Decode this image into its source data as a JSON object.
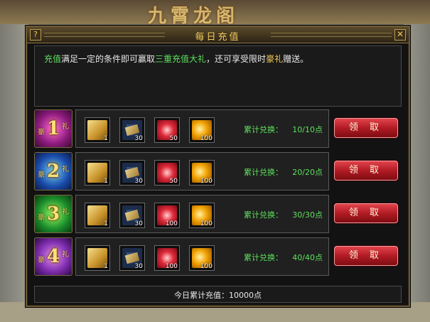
{
  "background": {
    "title": "九霄龙阁"
  },
  "window": {
    "title": "每日充值",
    "help_label": "?",
    "close_label": "✕"
  },
  "description": {
    "p1": "充值",
    "p2": "满足一定的条件即可赢取",
    "p3": "三重充值大礼",
    "p4": "，还可享受限时",
    "p5": "豪礼",
    "p6": "赠送。"
  },
  "rows": [
    {
      "badge_num": "1",
      "badge_a": "豪",
      "badge_b": "礼",
      "items": [
        "1",
        "30",
        "50",
        "100"
      ],
      "label": "累计兑换：",
      "progress": "10/10点",
      "button": "领 取"
    },
    {
      "badge_num": "2",
      "badge_a": "豪",
      "badge_b": "礼",
      "items": [
        "1",
        "30",
        "50",
        "100"
      ],
      "label": "累计兑换：",
      "progress": "20/20点",
      "button": "领 取"
    },
    {
      "badge_num": "3",
      "badge_a": "豪",
      "badge_b": "礼",
      "items": [
        "1",
        "30",
        "100",
        "100"
      ],
      "label": "累计兑换：",
      "progress": "30/30点",
      "button": "领 取"
    },
    {
      "badge_num": "4",
      "badge_a": "豪",
      "badge_b": "礼",
      "items": [
        "1",
        "30",
        "100",
        "100"
      ],
      "label": "累计兑换：",
      "progress": "40/40点",
      "button": "领 取"
    }
  ],
  "item_icons": [
    "scroll-icon",
    "book-icon",
    "red-burst-icon",
    "gold-ingot-icon"
  ],
  "footer": {
    "text": "今日累计充值：10000点"
  },
  "colors": {
    "accent_gold": "#f2c85a",
    "green_text": "#5ee05e",
    "button_red": "#b11b24"
  }
}
